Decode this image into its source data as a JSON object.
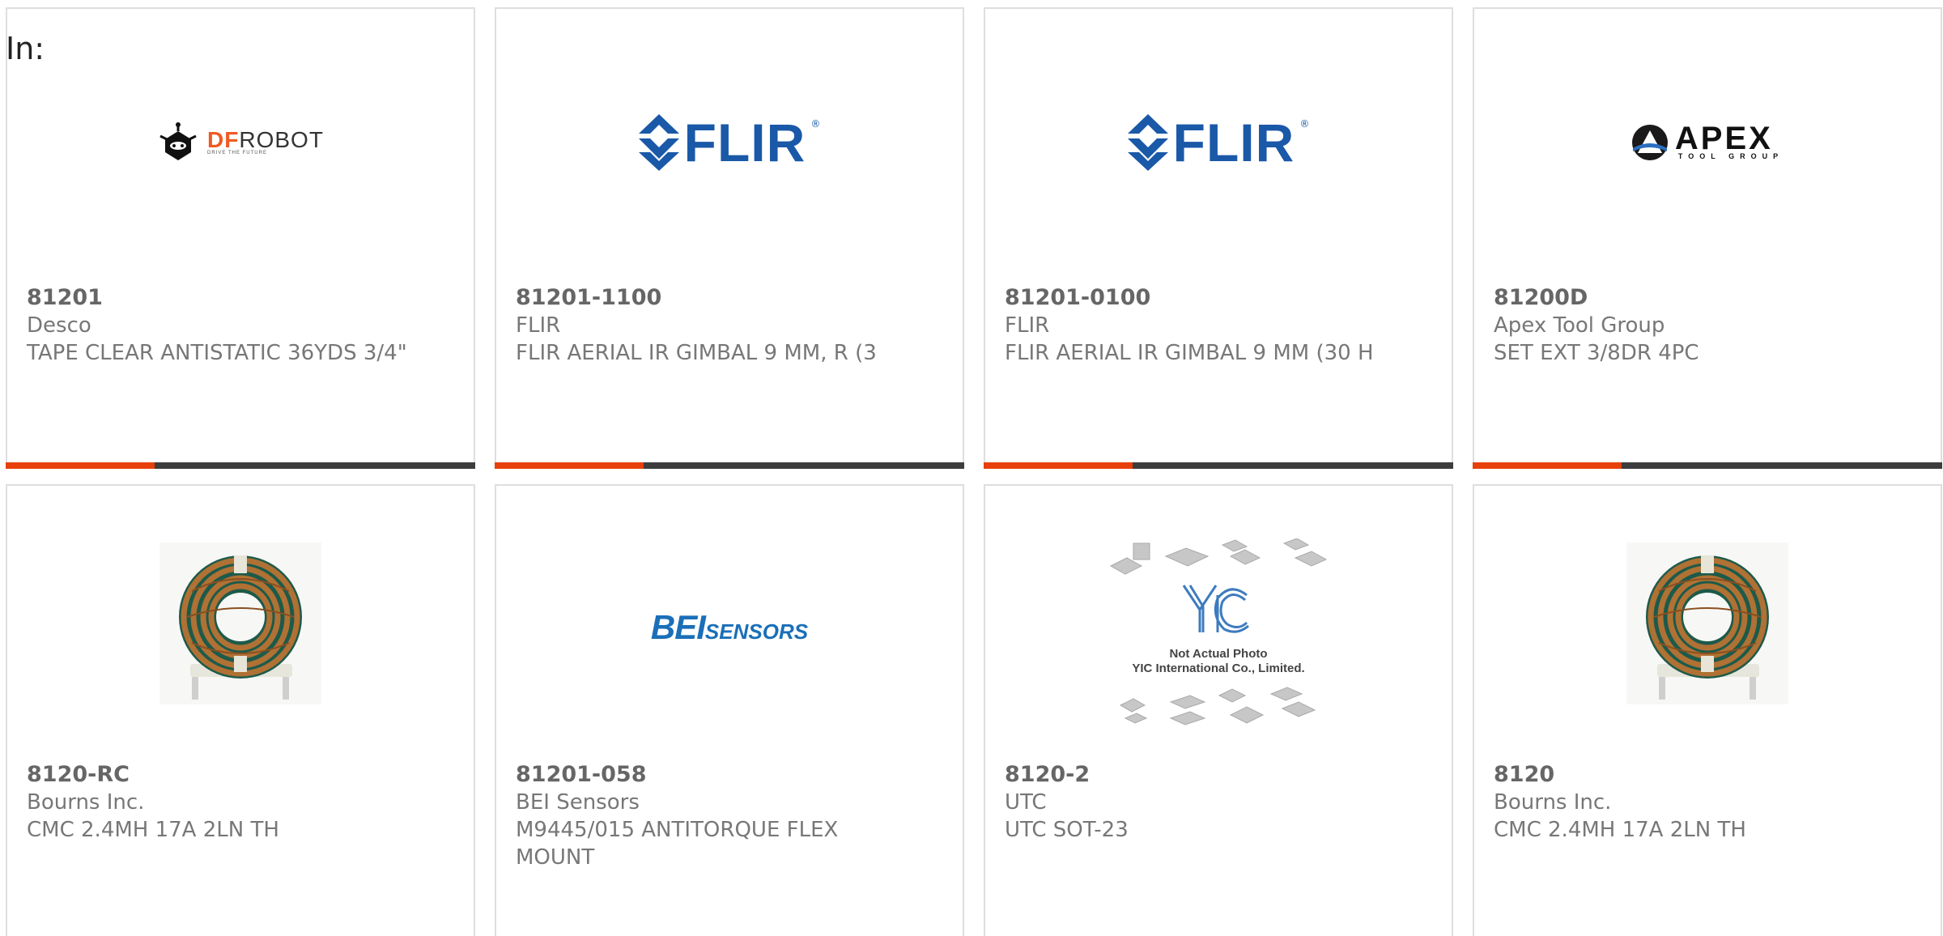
{
  "filter_label": "In:",
  "colors": {
    "accent": "#e8400c",
    "bar": "#3d3d3d",
    "card_border": "#dedede",
    "flir_blue": "#1a58a8",
    "bei_blue": "#1a6fb8",
    "dfrobot_orange": "#f05a22"
  },
  "products": [
    {
      "part_number": "81201",
      "manufacturer": "Desco",
      "description": "TAPE CLEAR ANTISTATIC 36YDS 3/4\"",
      "image": "dfrobot-logo",
      "logo": {
        "brand_df": "DF",
        "brand_robot": "ROBOT",
        "tagline": "DRIVE THE FUTURE"
      }
    },
    {
      "part_number": "81201-1100",
      "manufacturer": "FLIR",
      "description": "FLIR AERIAL IR GIMBAL 9 MM, R (3",
      "image": "flir-logo",
      "logo": {
        "brand": "FLIR",
        "mark": "®"
      }
    },
    {
      "part_number": "81201-0100",
      "manufacturer": "FLIR",
      "description": "FLIR AERIAL IR GIMBAL 9 MM (30 H",
      "image": "flir-logo",
      "logo": {
        "brand": "FLIR",
        "mark": "®"
      }
    },
    {
      "part_number": "81200D",
      "manufacturer": "Apex Tool Group",
      "description": "SET EXT 3/8DR 4PC",
      "image": "apex-logo",
      "logo": {
        "brand": "APEX",
        "tagline": "TOOL GROUP"
      }
    },
    {
      "part_number": "8120-RC",
      "manufacturer": "Bourns Inc.",
      "description": "CMC 2.4MH 17A 2LN TH",
      "image": "toroid-inductor-photo"
    },
    {
      "part_number": "81201-058",
      "manufacturer": "BEI Sensors",
      "description": "M9445/015 ANTITORQUE FLEX MOUNT",
      "image": "bei-sensors-logo",
      "logo": {
        "brand_big": "BEI",
        "brand_small": "SENSORS"
      }
    },
    {
      "part_number": "8120-2",
      "manufacturer": "UTC",
      "description": "UTC SOT-23",
      "image": "yic-placeholder",
      "logo": {
        "caption_1": "Not Actual Photo",
        "caption_2": "YIC International Co., Limited."
      }
    },
    {
      "part_number": "8120",
      "manufacturer": "Bourns Inc.",
      "description": "CMC 2.4MH 17A 2LN TH",
      "image": "toroid-inductor-photo"
    }
  ]
}
